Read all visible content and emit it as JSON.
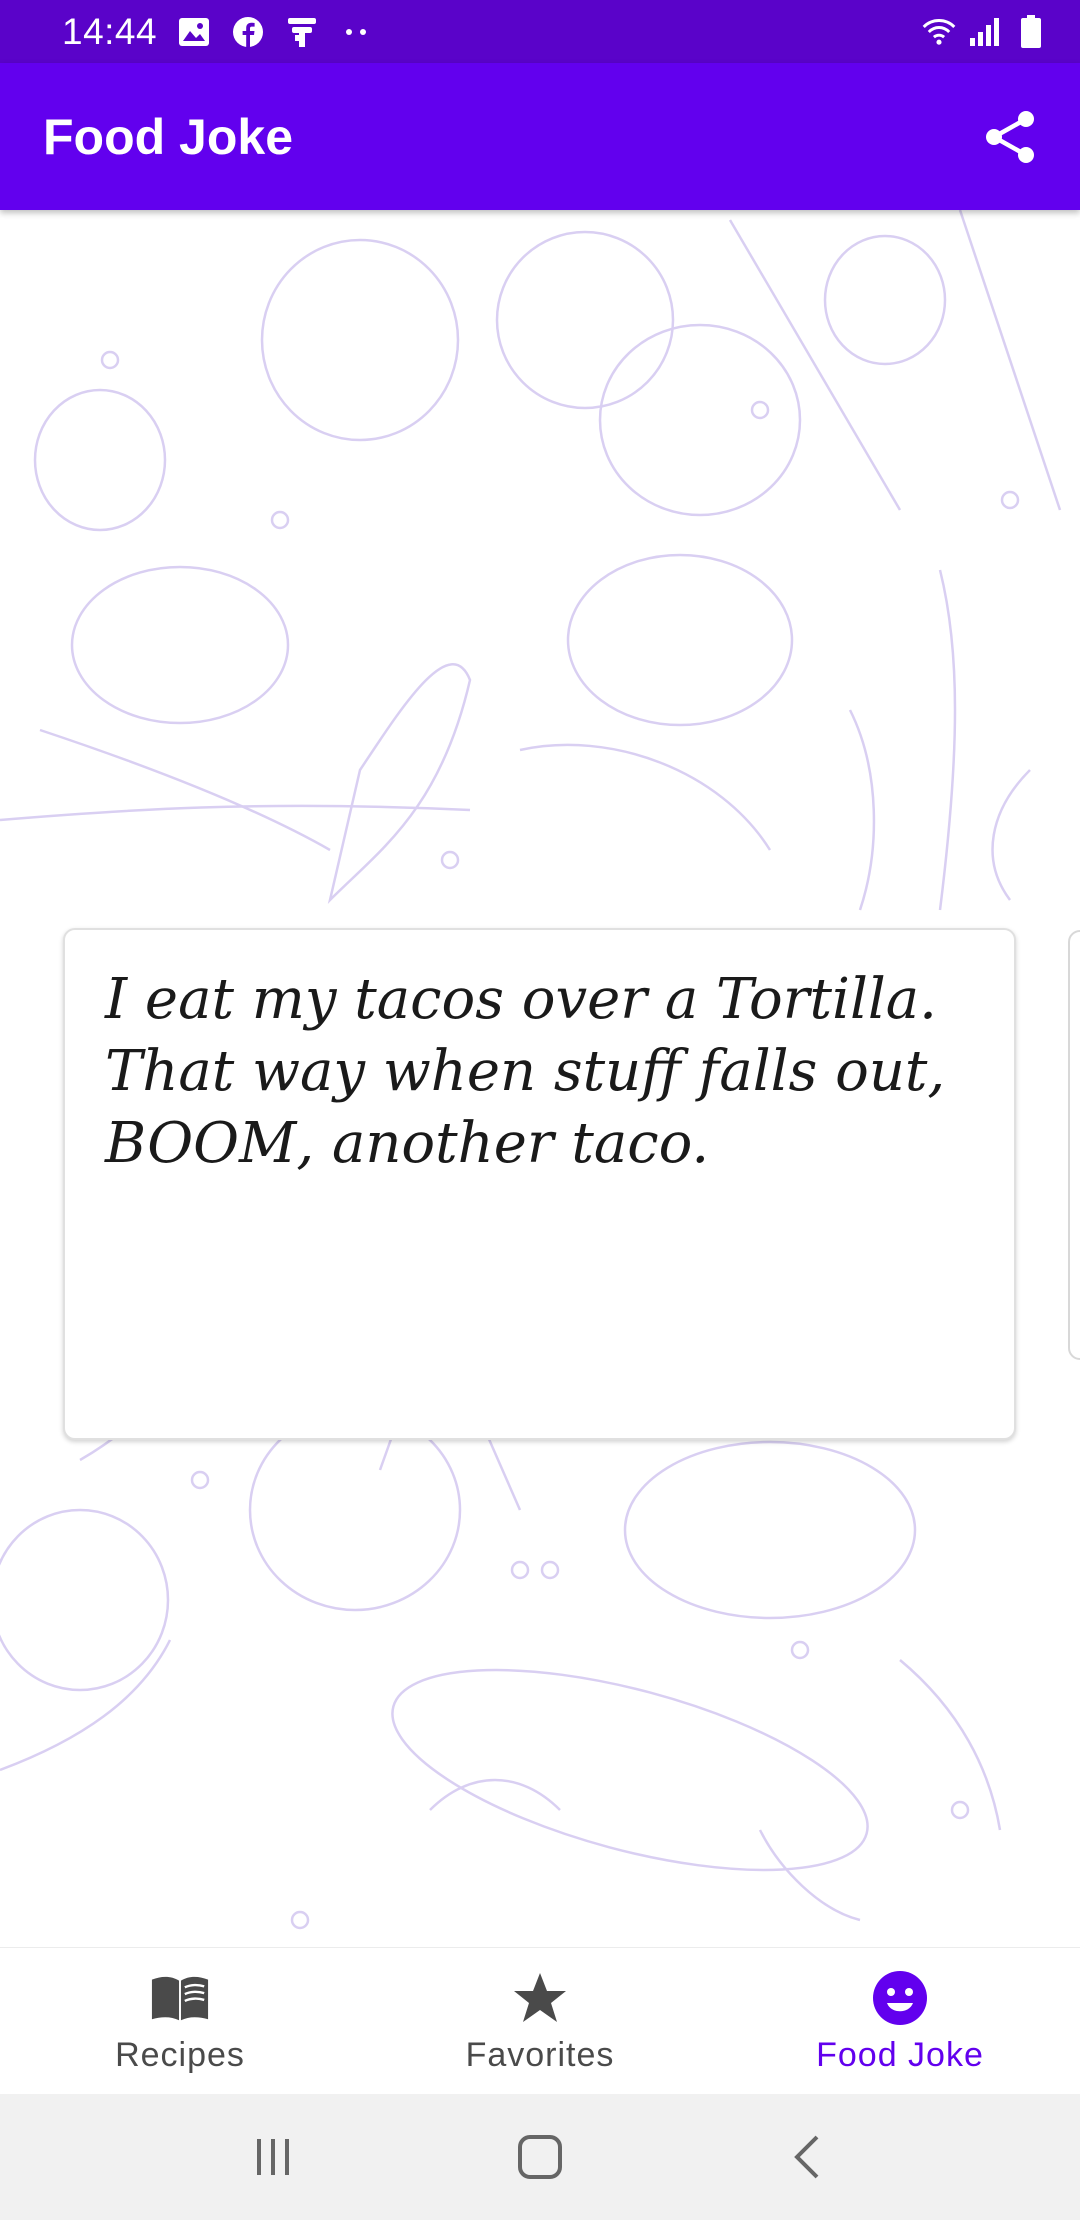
{
  "status_bar": {
    "time": "14:44",
    "notification_icons": [
      "image-icon",
      "facebook-icon",
      "pin-icon",
      "more-dots-icon"
    ],
    "system_icons": [
      "wifi-icon",
      "signal-icon",
      "battery-icon"
    ]
  },
  "app_bar": {
    "title": "Food Joke",
    "action_icon": "share-icon",
    "background_color": "#6200ee"
  },
  "joke": {
    "text": "I eat my tacos over a Tortilla. That way when stuff falls out, BOOM, another taco."
  },
  "bottom_nav": {
    "items": [
      {
        "label": "Recipes",
        "icon": "book-icon",
        "active": false
      },
      {
        "label": "Favorites",
        "icon": "star-icon",
        "active": false
      },
      {
        "label": "Food Joke",
        "icon": "smiley-icon",
        "active": true
      }
    ],
    "active_color": "#6200ee",
    "inactive_color": "#4a4a4a"
  },
  "system_nav": {
    "buttons": [
      "recents-icon",
      "home-icon",
      "back-icon"
    ]
  }
}
